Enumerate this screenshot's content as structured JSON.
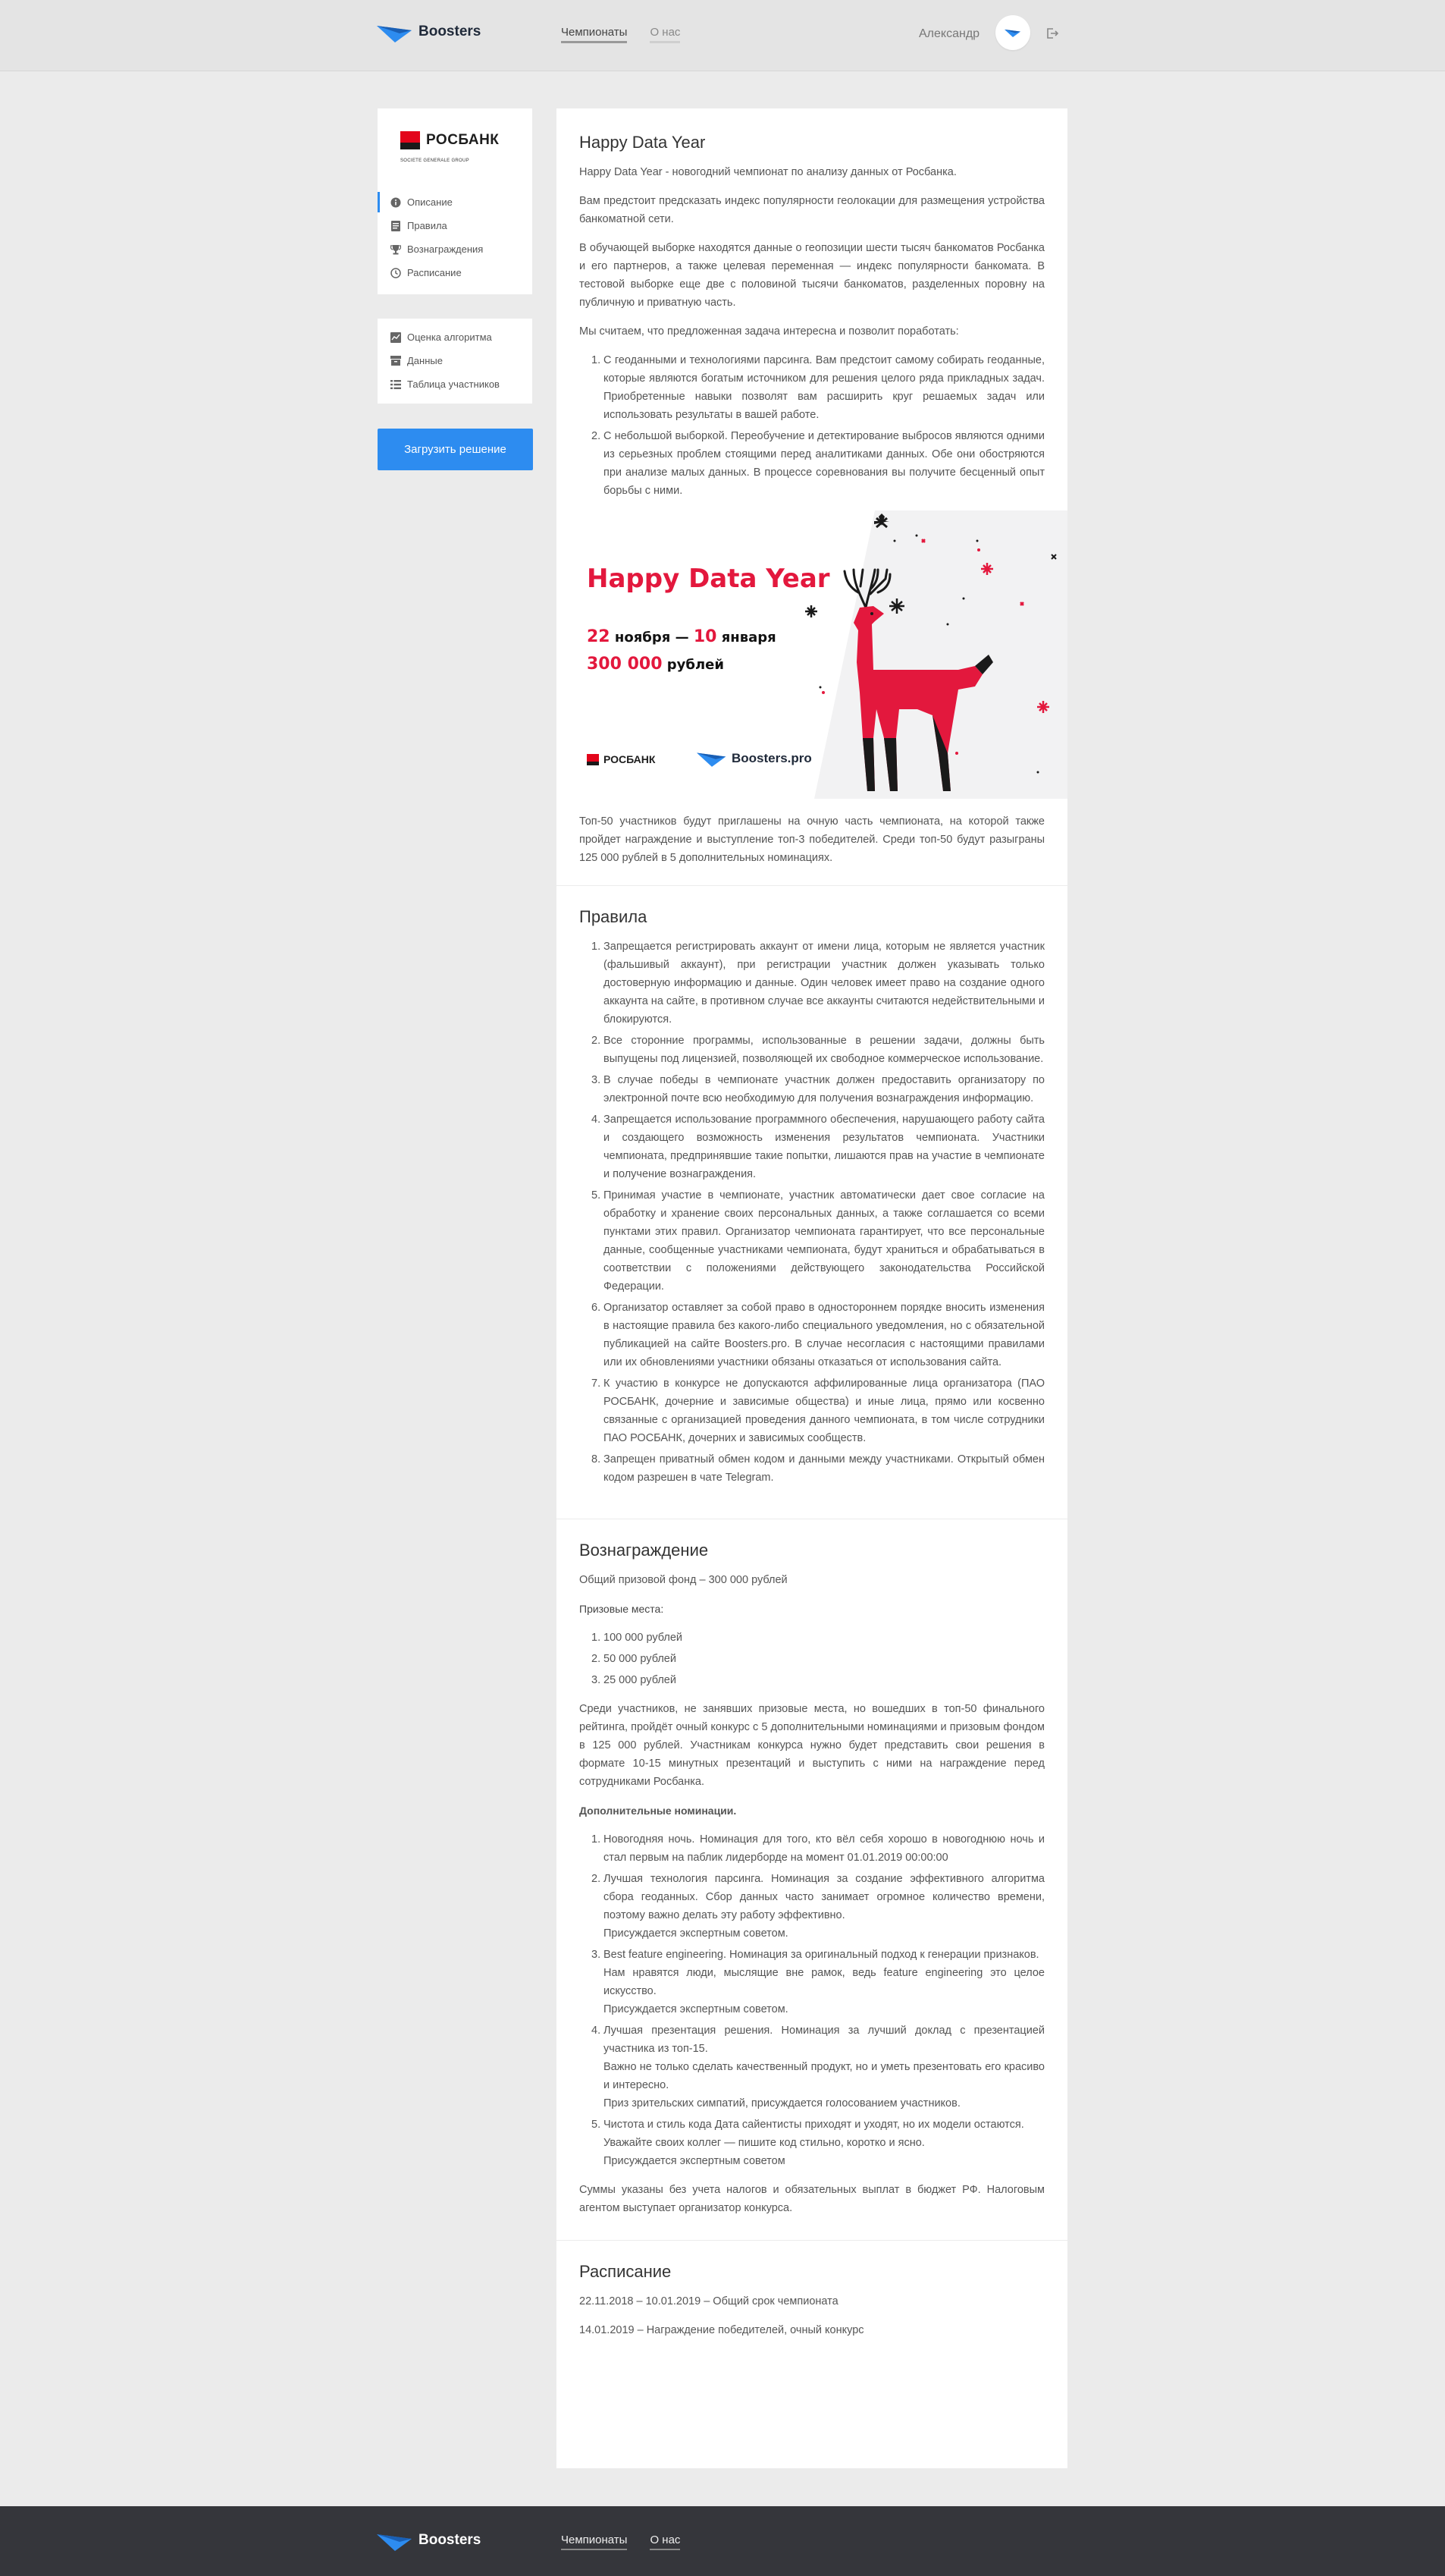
{
  "header": {
    "logo_text": "Boosters",
    "nav": [
      {
        "label": "Чемпионаты"
      },
      {
        "label": "О нас"
      }
    ],
    "user_name": "Александр"
  },
  "sidebar": {
    "brand_word": "РОСБАНК",
    "brand_sub": "SOCIETE GENERALE GROUP",
    "menu": [
      {
        "label": "Описание",
        "icon": "info-icon",
        "active": true
      },
      {
        "label": "Правила",
        "icon": "document-icon"
      },
      {
        "label": "Вознаграждения",
        "icon": "trophy-icon"
      },
      {
        "label": "Расписание",
        "icon": "clock-icon"
      }
    ],
    "tools": [
      {
        "label": "Оценка алгоритма",
        "icon": "chart-icon"
      },
      {
        "label": "Данные",
        "icon": "archive-icon"
      },
      {
        "label": "Таблица участников",
        "icon": "list-icon"
      }
    ],
    "upload_button": "Загрузить решение"
  },
  "description": {
    "title": "Happy Data Year",
    "p1": "Happy Data Year - новогодний чемпионат по анализу данных от Росбанка.",
    "p2": "Вам предстоит предсказать индекс популярности геолокации для размещения устройства банкоматной сети.",
    "p3": "В обучающей выборке находятся данные о геопозиции шести тысяч банкоматов Росбанка и его партнеров, а также целевая переменная — индекс популярности банкомата. В тестовой выборке еще две с половиной тысячи банкоматов, разделенных поровну на публичную и приватную часть.",
    "p4": "Мы считаем, что предложенная задача интересна и позволит поработать:",
    "list": [
      "С геоданными и технологиями парсинга. Вам предстоит самому собирать геоданные, которые являются богатым источником для решения целого ряда прикладных задач. Приобретенные навыки позволят вам расширить круг решаемых задач или использовать результаты в вашей работе.",
      "С небольшой выборкой. Переобучение и детектирование выбросов являются одними из серьезных проблем стоящими перед аналитиками данных. Обе они обостряются при анализе малых данных. В процессе соревнования вы получите бесценный опыт борьбы с ними."
    ],
    "banner": {
      "title": "Happy Data Year",
      "date_start_num": "22",
      "date_start_month": "ноября",
      "date_dash": "—",
      "date_end_num": "10",
      "date_end_month": "января",
      "prize_num": "300 000",
      "prize_unit": "рублей",
      "rosbank": "РОСБАНК",
      "boosters": "Boosters.pro"
    },
    "p5": "Топ-50 участников будут приглашены на очную часть чемпионата, на которой также пройдет награждение и выступление топ-3 победителей. Среди топ-50 будут разыграны 125 000 рублей в 5 дополнительных номинациях."
  },
  "rules": {
    "title": "Правила",
    "items": [
      "Запрещается регистрировать аккаунт от имени лица, которым не является участник (фальшивый аккаунт), при регистрации участник должен указывать только достоверную информацию и данные. Один человек имеет право на создание одного аккаунта на сайте, в противном случае все аккаунты считаются недействительными и блокируются.",
      "Все сторонние программы, использованные в решении задачи, должны быть выпущены под лицензией, позволяющей их свободное коммерческое использование.",
      "В случае победы в чемпионате участник должен предоставить организатору по электронной почте всю необходимую для получения вознаграждения информацию.",
      "Запрещается использование программного обеспечения, нарушающего работу сайта и создающего возможность изменения результатов чемпионата. Участники чемпионата, предпринявшие такие попытки, лишаются прав на участие в чемпионате и получение вознаграждения.",
      "Принимая участие в чемпионате, участник автоматически дает свое согласие на обработку и хранение своих персональных данных, а также соглашается со всеми пунктами этих правил. Организатор чемпионата гарантирует, что все персональные данные, сообщенные участниками чемпионата, будут храниться и обрабатываться в соответствии с положениями действующего законодательства Российской Федерации.",
      "Организатор оставляет за собой право в одностороннем порядке вносить изменения в настоящие правила без какого-либо специального уведомления, но с обязательной публикацией на сайте Boosters.pro. В случае несогласия с настоящими правилами или их обновлениями участники обязаны отказаться от использования сайта.",
      "К участию в конкурсе не допускаются аффилированные лица организатора (ПАО РОСБАНК, дочерние и зависимые общества) и иные лица, прямо или косвенно связанные с организацией проведения данного чемпионата, в том числе сотрудники ПАО РОСБАНК, дочерних и зависимых сообществ.",
      "Запрещен приватный обмен кодом и данными между участниками. Открытый обмен кодом разрешен в чате Telegram."
    ]
  },
  "rewards": {
    "title": "Вознаграждение",
    "fund": "Общий призовой фонд – 300 000 рублей",
    "places_heading": "Призовые места:",
    "places": [
      "100 000 рублей",
      "50 000 рублей",
      "25 000 рублей"
    ],
    "p_final": "Среди участников, не занявших призовые места, но вошедших в топ-50 финального рейтинга, пройдёт очный конкурс с 5 дополнительными номинациями и призовым фондом в 125 000 рублей. Участникам конкурса нужно будет представить свои решения в формате 10-15 минутных презентаций и выступить с ними на награждение перед сотрудниками Росбанка.",
    "nominations_heading": "Дополнительные номинации.",
    "nominations": [
      [
        "Новогодняя ночь. Номинация для того, кто вёл себя хорошо в новогоднюю ночь и стал первым на паблик лидерборде на момент 01.01.2019 00:00:00"
      ],
      [
        "Лучшая технология парсинга. Номинация за создание эффективного алгоритма сбора геоданных. Сбор данных часто занимает огромное количество времени, поэтому важно делать эту работу эффективно.",
        "Присуждается экспертным советом."
      ],
      [
        "Best feature engineering. Номинация за оригинальный подход к генерации признаков.",
        "Нам нравятся люди, мыслящие вне рамок, ведь feature engineering это целое искусство.",
        "Присуждается экспертным советом."
      ],
      [
        "Лучшая презентация решения. Номинация за лучший доклад с презентацией участника из топ-15.",
        "Важно не только сделать качественный продукт, но и уметь презентовать его красиво и интересно.",
        "Приз зрительских симпатий, присуждается голосованием участников."
      ],
      [
        "Чистота и стиль кода Дата сайентисты приходят и уходят, но их модели остаются.",
        "Уважайте своих коллег — пишите код стильно, коротко и ясно.",
        "Присуждается экспертным советом"
      ]
    ],
    "p_tax": "Суммы указаны без учета налогов и обязательных выплат в бюджет РФ. Налоговым агентом выступает организатор конкурса."
  },
  "schedule": {
    "title": "Расписание",
    "items": [
      "22.11.2018 – 10.01.2019 – Общий срок чемпионата",
      "14.01.2019 – Награждение победителей, очный конкурс"
    ]
  },
  "footer": {
    "logo_text": "Boosters",
    "nav": [
      {
        "label": "Чемпионаты"
      },
      {
        "label": "О нас"
      }
    ]
  },
  "colors": {
    "accent": "#2d8cf0",
    "brand_red": "#e3183d",
    "footer_bg": "#35363b",
    "page_bg": "#ebebeb"
  }
}
